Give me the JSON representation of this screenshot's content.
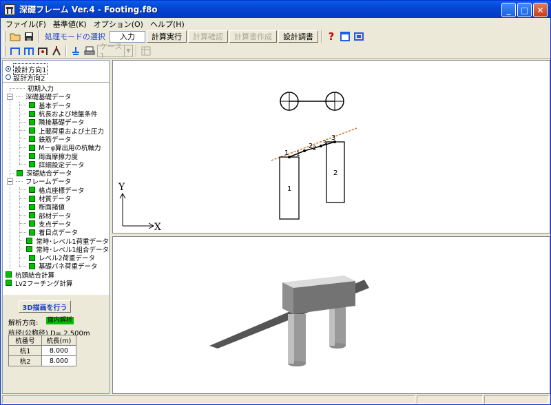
{
  "window": {
    "title": "深礎フレーム Ver.4 - Footing.f8o"
  },
  "title_buttons": {
    "minimize": "_",
    "maximize": "□",
    "close": "✕"
  },
  "menu": [
    "ファイル(F)",
    "基準値(K)",
    "オプション(O)",
    "ヘルプ(H)"
  ],
  "toolbar": {
    "mode_label": "処理モードの選択",
    "mode_value": "入力",
    "buttons": [
      "計算実行",
      "計算確認",
      "計算書作成",
      "設計調書"
    ],
    "disabled": [
      false,
      true,
      true,
      false
    ],
    "case_combo": "ケース1"
  },
  "left": {
    "radios": [
      {
        "label": "設計方向1",
        "selected": true
      },
      {
        "label": "設計方向2",
        "selected": false
      }
    ],
    "tree": {
      "initial": "初期入力",
      "group1": "深礎基礎データ",
      "group1_items": [
        "基本データ",
        "杭長および地盤条件",
        "隣接基礎データ",
        "上載荷重および土圧力",
        "鉄筋データ",
        "M－φ算出用の杭軸力",
        "周面摩擦力度",
        "詳細設定データ"
      ],
      "joint": "深礎結合データ",
      "group2": "フレームデータ",
      "group2_items": [
        "格点座標データ",
        "材質データ",
        "断面諸値",
        "部材データ",
        "支点データ",
        "着目点データ",
        "常時･レベル1荷重データ",
        "常時･レベル1組合データ",
        "レベル2荷重データ",
        "基礎バネ荷重データ"
      ],
      "tail": [
        "杭頭結合計算",
        "Lv2フーチング計算"
      ]
    },
    "button_3d": "3D描画を行う",
    "analysis_label": "解析方向:",
    "analysis_value": "面内解析",
    "diameter_label": "杭径(公称径) D= 2.500m",
    "table": {
      "headers": [
        "杭番号",
        "杭長(m)"
      ],
      "rows": [
        [
          "杭1",
          "8.000"
        ],
        [
          "杭2",
          "8.000"
        ]
      ]
    }
  },
  "view_top": {
    "axis_y": "Y",
    "axis_x": "X",
    "pile_labels": [
      "1",
      "2"
    ],
    "node_labels": [
      "1",
      "2",
      "3"
    ],
    "member_labels": [
      "1",
      "2",
      "3"
    ]
  }
}
